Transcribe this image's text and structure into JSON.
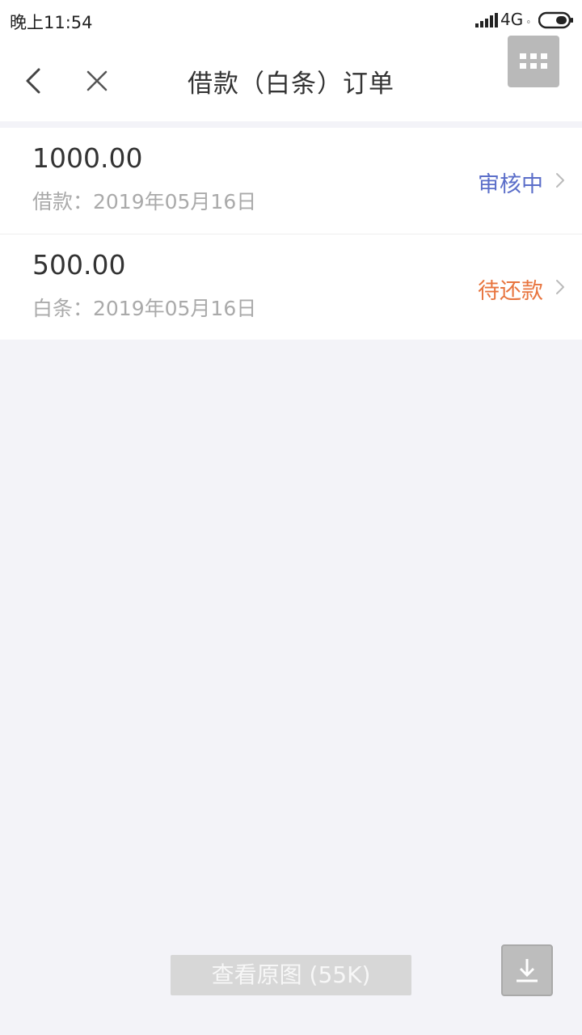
{
  "status_bar": {
    "time": "晚上11:54",
    "network": "4G",
    "network_sub": "₀"
  },
  "nav": {
    "title": "借款（白条）订单"
  },
  "orders": [
    {
      "amount": "1000.00",
      "meta": "借款：2019年05月16日",
      "status": "审核中",
      "status_color": "#5b6ec9"
    },
    {
      "amount": "500.00",
      "meta": "白条：2019年05月16日",
      "status": "待还款",
      "status_color": "#e8753f"
    }
  ],
  "image_viewer": {
    "view_original_label": "查看原图 (55K)"
  },
  "icons": {
    "back": "back-icon",
    "close": "close-icon",
    "menu": "grid-menu-icon",
    "chevron": "chevron-right-icon",
    "download": "download-icon"
  }
}
